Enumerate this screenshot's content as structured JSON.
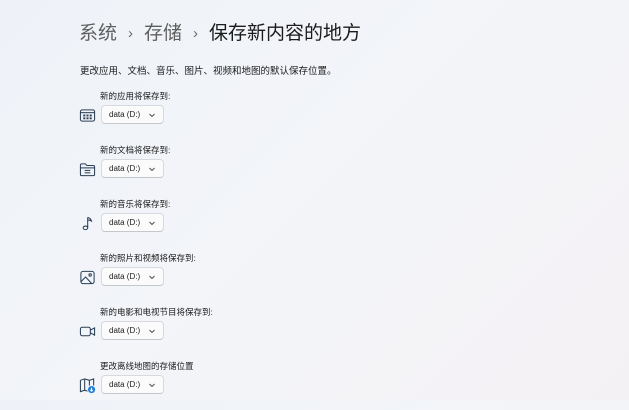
{
  "breadcrumb": {
    "items": [
      "系统",
      "存储"
    ],
    "current": "保存新内容的地方",
    "separator": "›"
  },
  "description": "更改应用、文档、音乐、图片、视频和地图的默认保存位置。",
  "settings": [
    {
      "label": "新的应用将保存到:",
      "icon": "apps-icon",
      "value": "data (D:)"
    },
    {
      "label": "新的文档将保存到:",
      "icon": "documents-folder-icon",
      "value": "data (D:)"
    },
    {
      "label": "新的音乐将保存到:",
      "icon": "music-note-icon",
      "value": "data (D:)"
    },
    {
      "label": "新的照片和视频将保存到:",
      "icon": "photos-icon",
      "value": "data (D:)"
    },
    {
      "label": "新的电影和电视节目将保存到:",
      "icon": "video-camera-icon",
      "value": "data (D:)"
    },
    {
      "label": "更改离线地图的存储位置",
      "icon": "offline-maps-icon",
      "value": "data (D:)"
    }
  ],
  "colors": {
    "icon_stroke": "#2b3f55",
    "accent": "#1f7fd6",
    "text": "#1b1b1b",
    "muted_text": "#5f5f5f"
  }
}
